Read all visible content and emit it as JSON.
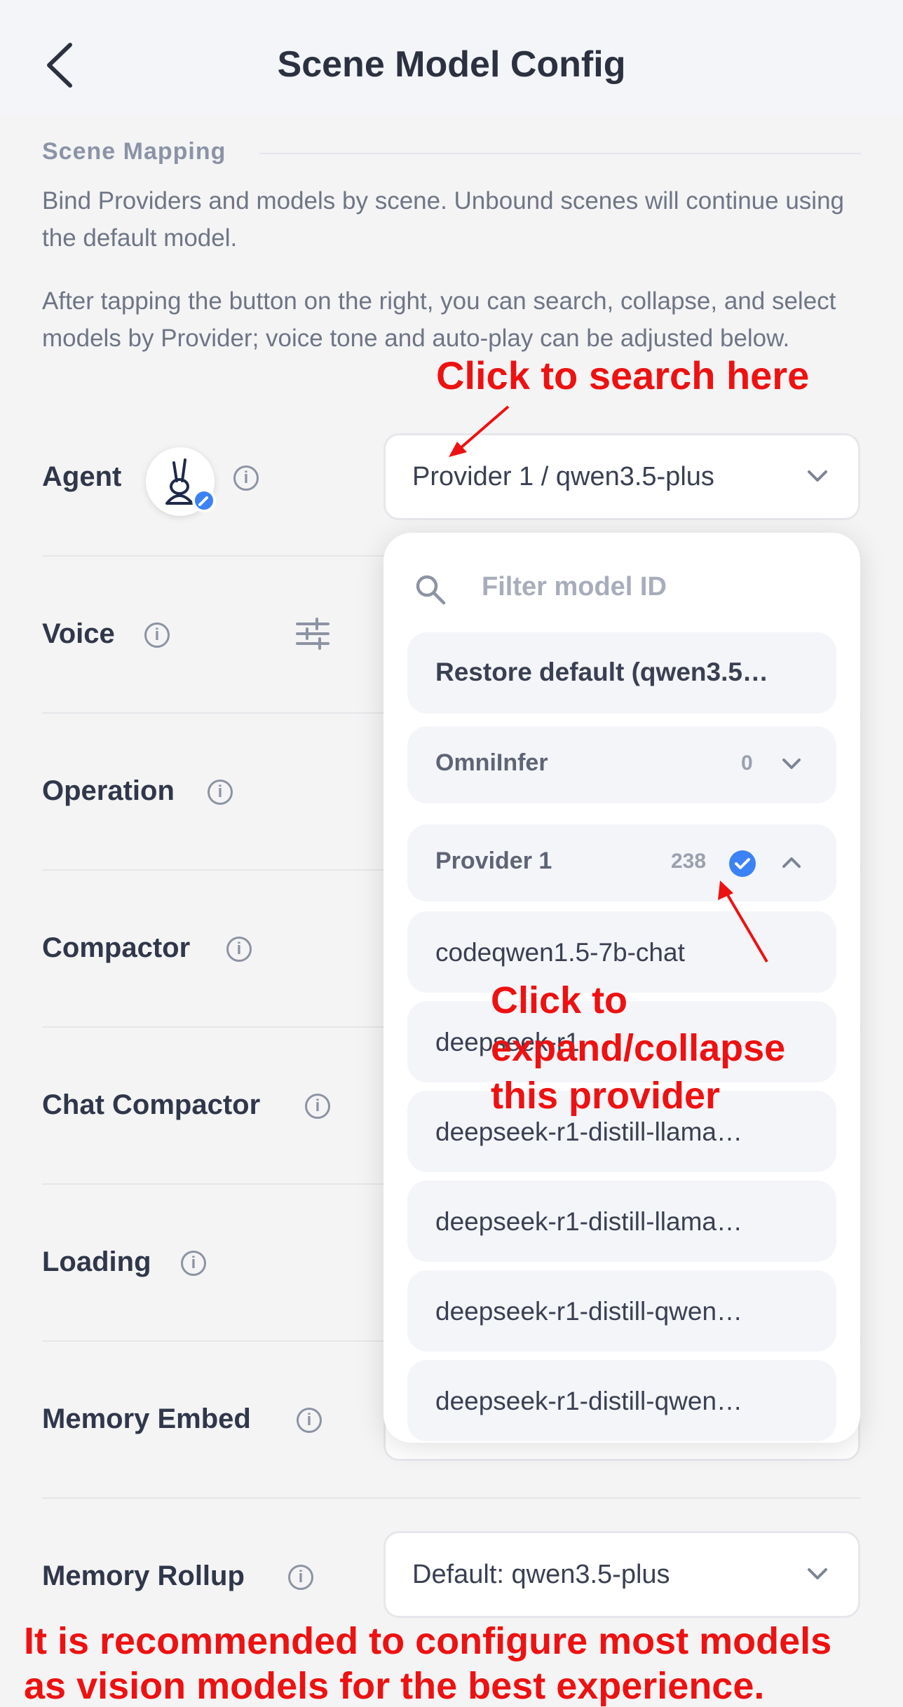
{
  "header": {
    "title": "Scene Model Config"
  },
  "section": {
    "label": "Scene Mapping",
    "description": "Bind Providers and models by scene. Unbound scenes will continue using the default model.",
    "hint": "After tapping the button on the right, you can search, collapse, and select models by Provider; voice tone and auto-play can be adjusted below."
  },
  "rows": {
    "agent": "Agent",
    "voice": "Voice",
    "operation": "Operation",
    "compactor": "Compactor",
    "chat_compactor": "Chat Compactor",
    "loading": "Loading",
    "memory_embed": "Memory Embed",
    "memory_rollup": "Memory Rollup"
  },
  "selects": {
    "agent_value": "Provider 1 / qwen3.5-plus",
    "memory_rollup_value": "Default: qwen3.5-plus"
  },
  "dropdown": {
    "filter_placeholder": "Filter model ID",
    "restore_default": "Restore default (qwen3.5…",
    "providers": [
      {
        "name": "OmniInfer",
        "count": "0",
        "expanded": false
      },
      {
        "name": "Provider 1",
        "count": "238",
        "expanded": true,
        "selected": true
      }
    ],
    "models": [
      "codeqwen1.5-7b-chat",
      "deepseek-r1",
      "deepseek-r1-distill-llama…",
      "deepseek-r1-distill-llama…",
      "deepseek-r1-distill-qwen…",
      "deepseek-r1-distill-qwen…"
    ]
  },
  "annotations": {
    "search": "Click to search here",
    "expand_line1": "Click to",
    "expand_line2": "expand/collapse",
    "expand_line3": "this provider",
    "footer_line1": "It is recommended to configure most models",
    "footer_line2": "as vision models for the best experience."
  },
  "colors": {
    "accent": "#3b82f6",
    "annotation": "#ee1111"
  },
  "icons": [
    "back-arrow-icon",
    "info-icon",
    "sliders-icon",
    "chevron-down-icon",
    "chevron-up-icon",
    "search-icon",
    "check-badge-icon",
    "edit-badge-icon",
    "agent-avatar-icon"
  ]
}
